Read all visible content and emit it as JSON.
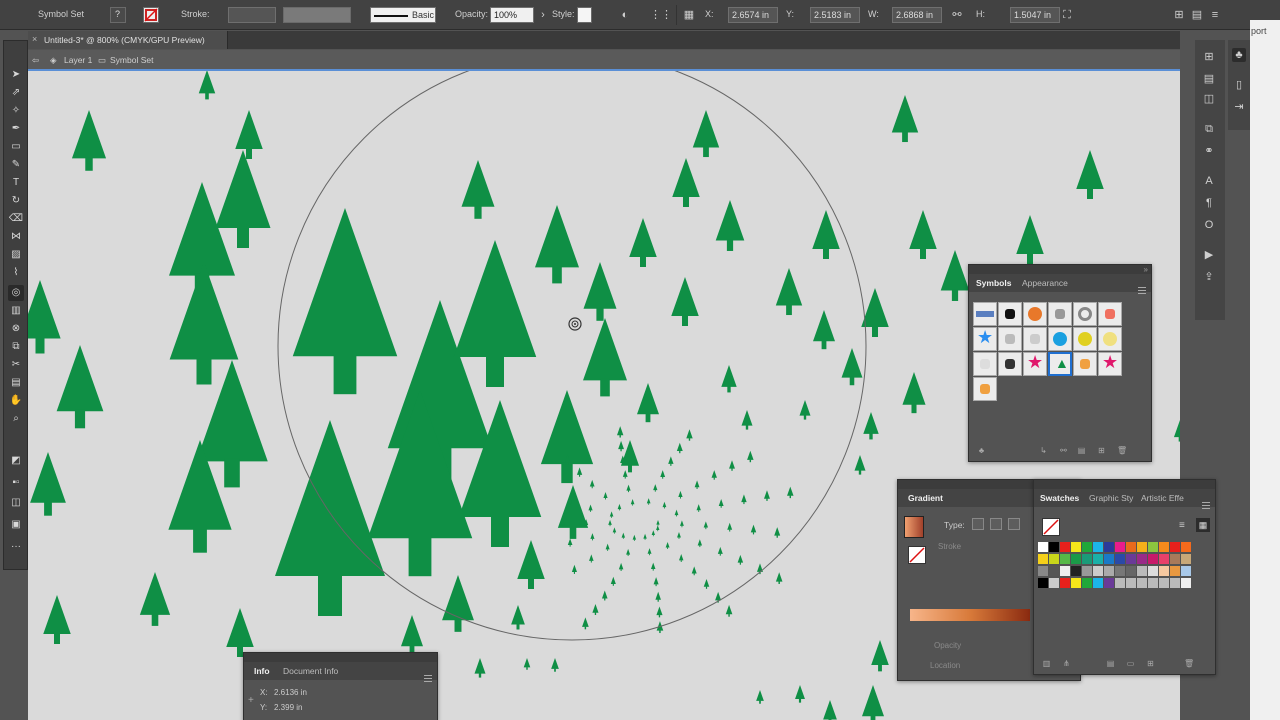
{
  "controlbar": {
    "selection_label": "Symbol Set",
    "stroke_label": "Stroke:",
    "brush_label": "Basic",
    "opacity_label": "Opacity:",
    "opacity_value": "100%",
    "style_label": "Style:",
    "x_label": "X:",
    "x_value": "2.6574 in",
    "y_label": "Y:",
    "y_value": "2.5183 in",
    "w_label": "W:",
    "w_value": "2.6868 in",
    "h_label": "H:",
    "h_value": "1.5047 in"
  },
  "document": {
    "tab_title": "Untitled-3* @ 800% (CMYK/GPU Preview)",
    "breadcrumb_layer": "Layer 1",
    "breadcrumb_object": "Symbol Set"
  },
  "right_edge_text": "port",
  "symbols_panel": {
    "tabs": [
      "Symbols",
      "Appearance"
    ]
  },
  "gradient_panel": {
    "tab": "Gradient",
    "type_label": "Type:",
    "stroke_label": "Stroke",
    "opacity_label": "Opacity",
    "location_label": "Location"
  },
  "swatches_panel": {
    "tabs": [
      "Swatches",
      "Graphic Sty",
      "Artistic Effe"
    ]
  },
  "info_panel": {
    "tabs": [
      "Info",
      "Document Info"
    ],
    "x_label": "X:",
    "x_value": "2.6136 in",
    "y_label": "Y:",
    "y_value": "2.399 in"
  },
  "colors": {
    "tree_green": "#0f8f45",
    "canvas": "#dadada",
    "isolation_bar": "#5a8fd6"
  }
}
